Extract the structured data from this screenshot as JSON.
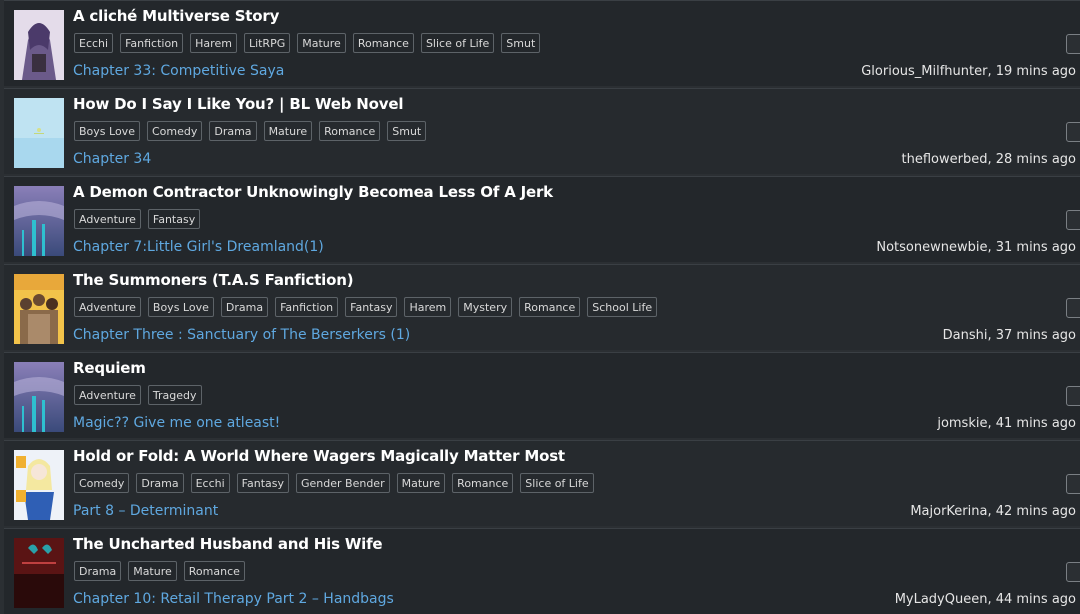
{
  "rows": [
    {
      "title": "A cliché Multiverse Story",
      "tags": [
        "Ecchi",
        "Fanfiction",
        "Harem",
        "LitRPG",
        "Mature",
        "Romance",
        "Slice of Life",
        "Smut"
      ],
      "chapter": "Chapter 33: Competitive Saya",
      "meta": "Glorious_Milfhunter, 19 mins ago",
      "cover_colors": [
        "#d7cde3",
        "#6b5a8a"
      ]
    },
    {
      "title": "How Do I Say I Like You? | BL Web Novel",
      "tags": [
        "Boys Love",
        "Comedy",
        "Drama",
        "Mature",
        "Romance",
        "Smut"
      ],
      "chapter": "Chapter 34",
      "meta": "theflowerbed, 28 mins ago",
      "cover_colors": [
        "#bfe3f2",
        "#9fd0ea"
      ]
    },
    {
      "title": "A Demon Contractor Unknowingly Becomea Less Of A Jerk",
      "tags": [
        "Adventure",
        "Fantasy"
      ],
      "chapter": "Chapter 7:Little Girl's Dreamland(1)",
      "meta": "Notsonewnewbie, 31 mins ago",
      "cover_colors": [
        "#7a6fa8",
        "#2e9ab0"
      ]
    },
    {
      "title": "The Summoners (T.A.S Fanfiction)",
      "tags": [
        "Adventure",
        "Boys Love",
        "Drama",
        "Fanfiction",
        "Fantasy",
        "Harem",
        "Mystery",
        "Romance",
        "School Life"
      ],
      "chapter": "Chapter Three : Sanctuary of The Berserkers (1)",
      "meta": "Danshi, 37 mins ago",
      "cover_colors": [
        "#f2c34a",
        "#8a6a3a"
      ]
    },
    {
      "title": "Requiem",
      "tags": [
        "Adventure",
        "Tragedy"
      ],
      "chapter": "Magic?? Give me one atleast!",
      "meta": "jomskie, 41 mins ago",
      "cover_colors": [
        "#7a6fa8",
        "#2e9ab0"
      ]
    },
    {
      "title": "Hold or Fold: A World Where Wagers Magically Matter Most",
      "tags": [
        "Comedy",
        "Drama",
        "Ecchi",
        "Fantasy",
        "Gender Bender",
        "Mature",
        "Romance",
        "Slice of Life"
      ],
      "chapter": "Part 8 – Determinant",
      "meta": "MajorKerina, 42 mins ago",
      "cover_colors": [
        "#eef2f8",
        "#2f5fb5"
      ]
    },
    {
      "title": "The Uncharted Husband and His Wife",
      "tags": [
        "Drama",
        "Mature",
        "Romance"
      ],
      "chapter": "Chapter 10: Retail Therapy Part 2 – Handbags",
      "meta": "MyLadyQueen, 44 mins ago",
      "cover_colors": [
        "#7a1a1a",
        "#2a0a0a"
      ]
    }
  ]
}
